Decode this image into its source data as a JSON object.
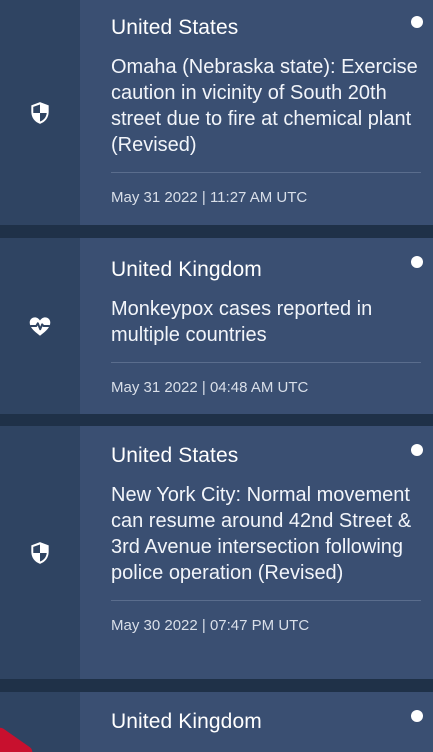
{
  "alerts": [
    {
      "country": "United States",
      "headline": "Omaha (Nebraska state): Exercise caution in vicinity of South 20th street due to fire at chemical plant (Revised)",
      "timestamp": "May 31 2022 | 11:27 AM UTC",
      "icon": "shield-icon",
      "unread": true
    },
    {
      "country": "United Kingdom",
      "headline": "Monkeypox cases reported in multiple countries",
      "timestamp": "May 31 2022 | 04:48 AM UTC",
      "icon": "health-heart-icon",
      "unread": true
    },
    {
      "country": "United States",
      "headline": "New York City: Normal movement can resume around 42nd Street & 3rd Avenue intersection following police operation (Revised)",
      "timestamp": "May 30 2022 | 07:47 PM UTC",
      "icon": "shield-icon",
      "unread": true
    },
    {
      "country": "United Kingdom",
      "icon": "warning-triangle-icon",
      "unread": true
    }
  ],
  "colors": {
    "background": "#1f3148",
    "rail": "#2f4462",
    "content": "#3a4f72",
    "text": "#ffffff",
    "alert_red": "#c8102e"
  }
}
